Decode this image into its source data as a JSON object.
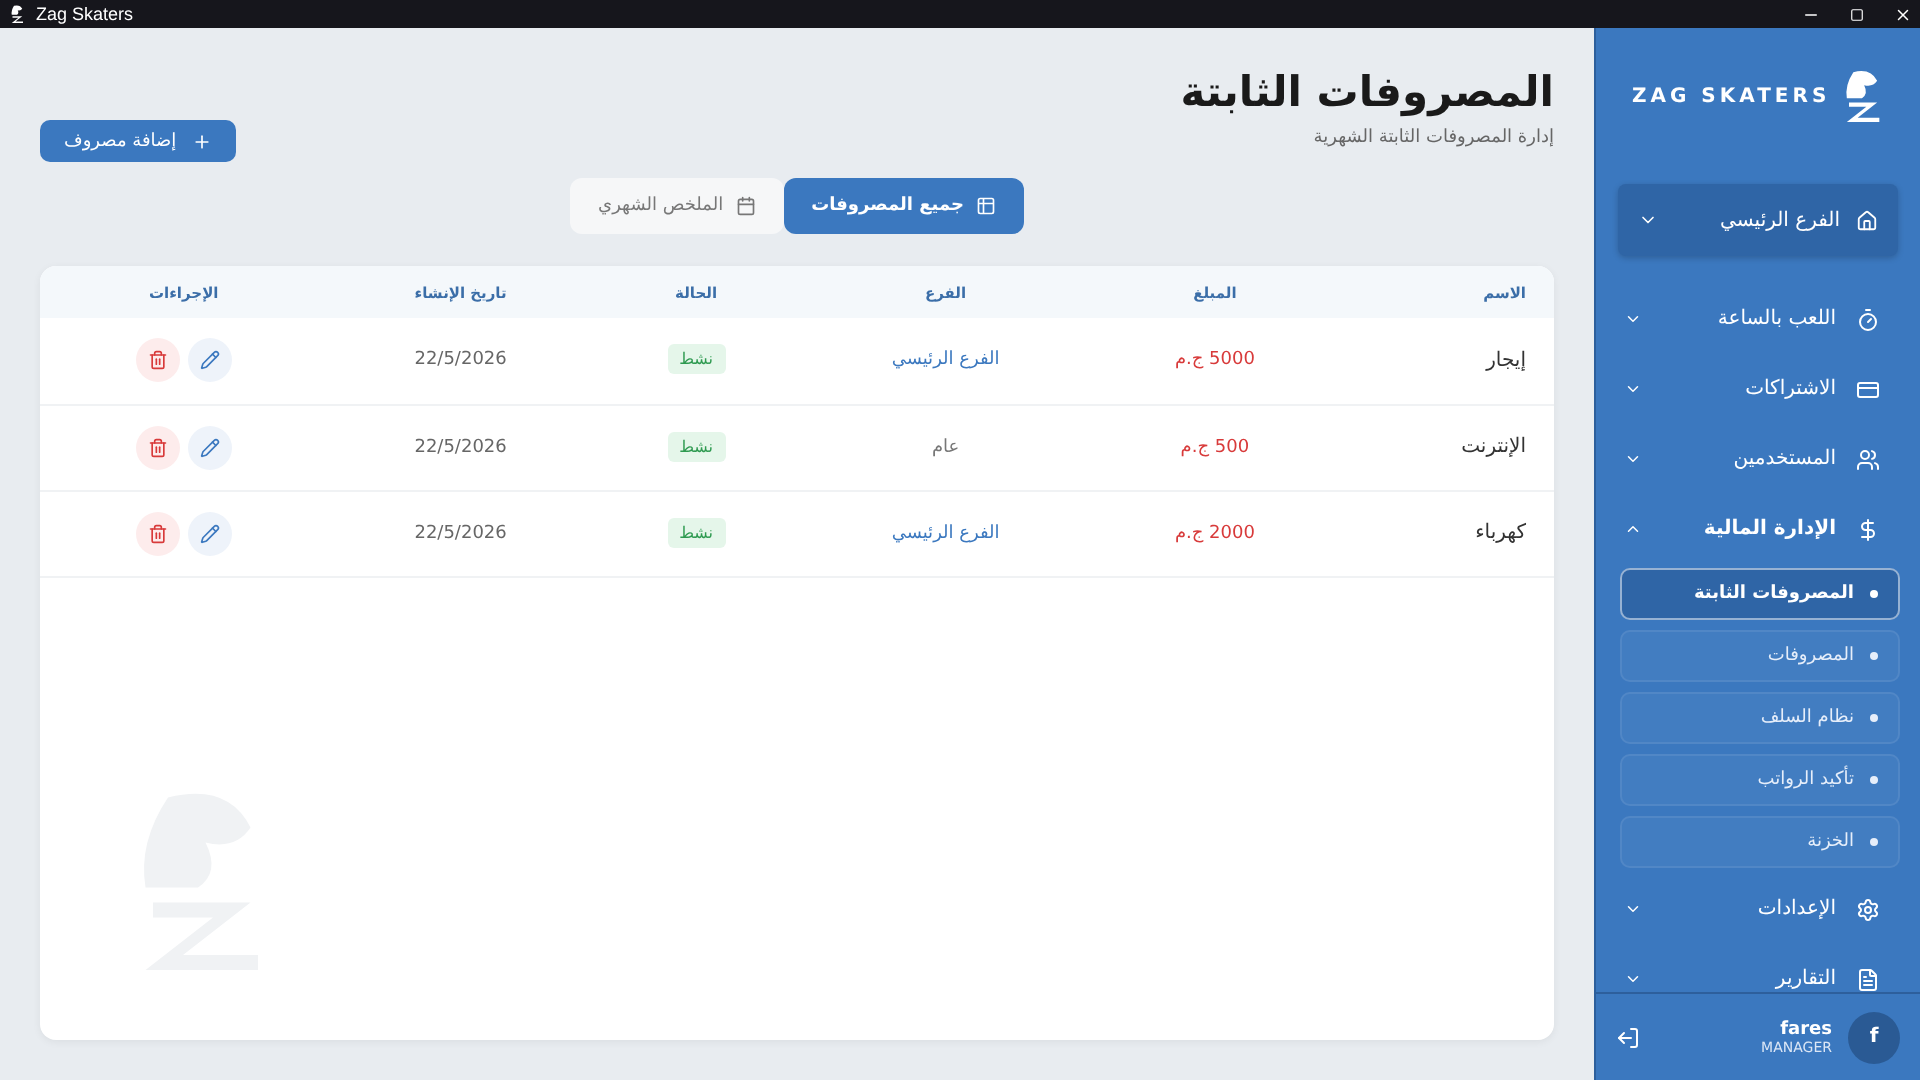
{
  "window": {
    "title": "Zag Skaters"
  },
  "header": {
    "title": "المصروفات الثابتة",
    "subtitle": "إدارة المصروفات الثابتة الشهرية",
    "add_button": "إضافة مصروف"
  },
  "tabs": [
    {
      "label": "جميع المصروفات",
      "selected": true
    },
    {
      "label": "الملخص الشهري",
      "selected": false
    }
  ],
  "table": {
    "columns": [
      "الاسم",
      "المبلغ",
      "الفرع",
      "الحالة",
      "تاريخ الإنشاء",
      "الإجراءات"
    ],
    "rows": [
      {
        "name": "إيجار",
        "amount": "5000 ج.م",
        "branch": {
          "text": "الفرع الرئيسي",
          "color": "#3b78bf"
        },
        "status": "نشط",
        "date": "22/5/2026"
      },
      {
        "name": "الإنترنت",
        "amount": "500 ج.م",
        "branch": {
          "text": "عام",
          "color": "#777777"
        },
        "status": "نشط",
        "date": "22/5/2026"
      },
      {
        "name": "كهرباء",
        "amount": "2000 ج.م",
        "branch": {
          "text": "الفرع الرئيسي",
          "color": "#3b78bf"
        },
        "status": "نشط",
        "date": "22/5/2026"
      }
    ]
  },
  "sidebar": {
    "brand": "ZAG SKATERS",
    "branch_selector": "الفرع الرئيسي",
    "items": [
      {
        "label": "اللعب بالساعة",
        "expanded": false
      },
      {
        "label": "الاشتراكات",
        "expanded": false
      },
      {
        "label": "المستخدمين",
        "expanded": false
      },
      {
        "label": "الإدارة المالية",
        "expanded": true,
        "children": [
          {
            "label": "المصروفات الثابتة",
            "selected": true
          },
          {
            "label": "المصروفات",
            "selected": false
          },
          {
            "label": "نظام السلف",
            "selected": false
          },
          {
            "label": "تأكيد الرواتب",
            "selected": false
          },
          {
            "label": "الخزنة",
            "selected": false
          }
        ]
      },
      {
        "label": "الإعدادات",
        "expanded": false
      },
      {
        "label": "التقارير",
        "expanded": false
      }
    ],
    "user": {
      "initial": "f",
      "name": "fares",
      "role": "MANAGER"
    }
  }
}
